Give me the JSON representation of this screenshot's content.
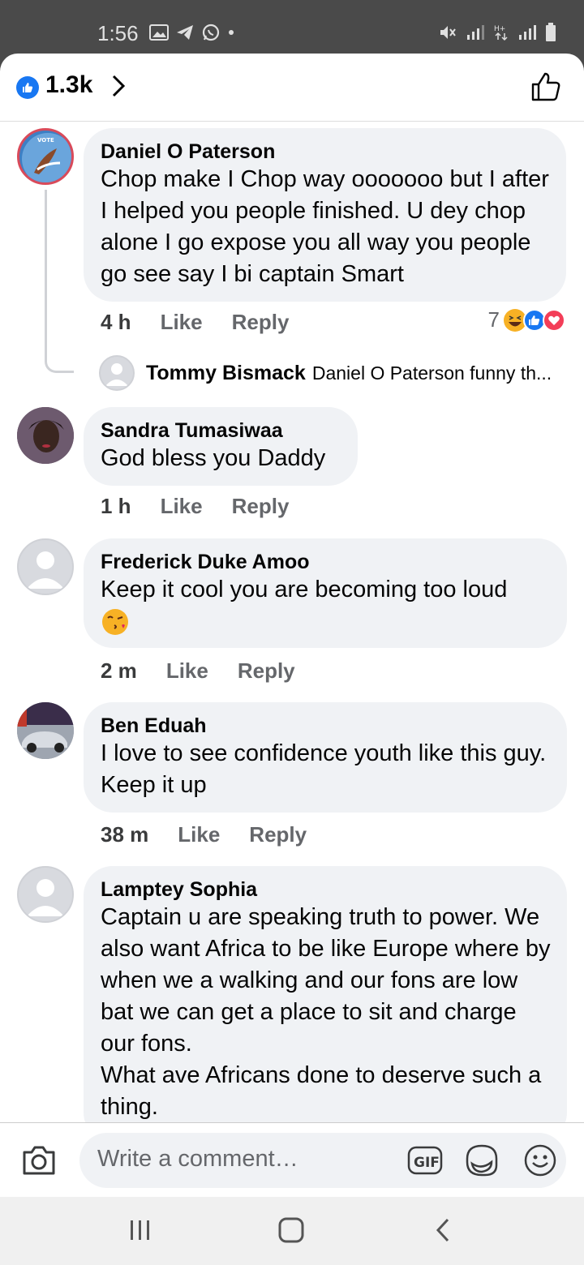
{
  "status_bar": {
    "time": "1:56"
  },
  "header": {
    "reaction_count": "1.3k"
  },
  "comments": [
    {
      "name": "Daniel O Paterson",
      "text": "Chop make I Chop way ooooooo but I after I helped you people finished. U dey chop alone I go expose you all way you people go see say I bi captain Smart",
      "time": "4 h",
      "like": "Like",
      "reply": "Reply",
      "reaction_count": "7",
      "reply_preview": {
        "name": "Tommy Bismack",
        "text": "Daniel O Paterson funny th..."
      }
    },
    {
      "name": "Sandra Tumasiwaa",
      "text": "God bless you Daddy",
      "time": "1 h",
      "like": "Like",
      "reply": "Reply"
    },
    {
      "name": "Frederick Duke Amoo",
      "text": "Keep it cool you are becoming too loud",
      "time": "2 m",
      "like": "Like",
      "reply": "Reply"
    },
    {
      "name": "Ben Eduah",
      "text": "I love to see confidence youth like this guy.  Keep it up",
      "time": "38 m",
      "like": "Like",
      "reply": "Reply"
    },
    {
      "name": "Lamptey Sophia",
      "text": "Captain u are speaking truth to power. We also want Africa to be like Europe where by when we a walking and our fons are low bat we can get a place to sit and charge our fons.\nWhat ave Africans done to deserve such a thing."
    }
  ],
  "composer": {
    "placeholder": "Write a comment…",
    "gif_label": "GIF"
  },
  "colors": {
    "accent": "#1877f2",
    "bubble": "#f0f2f5",
    "secondary_text": "#65676b"
  }
}
